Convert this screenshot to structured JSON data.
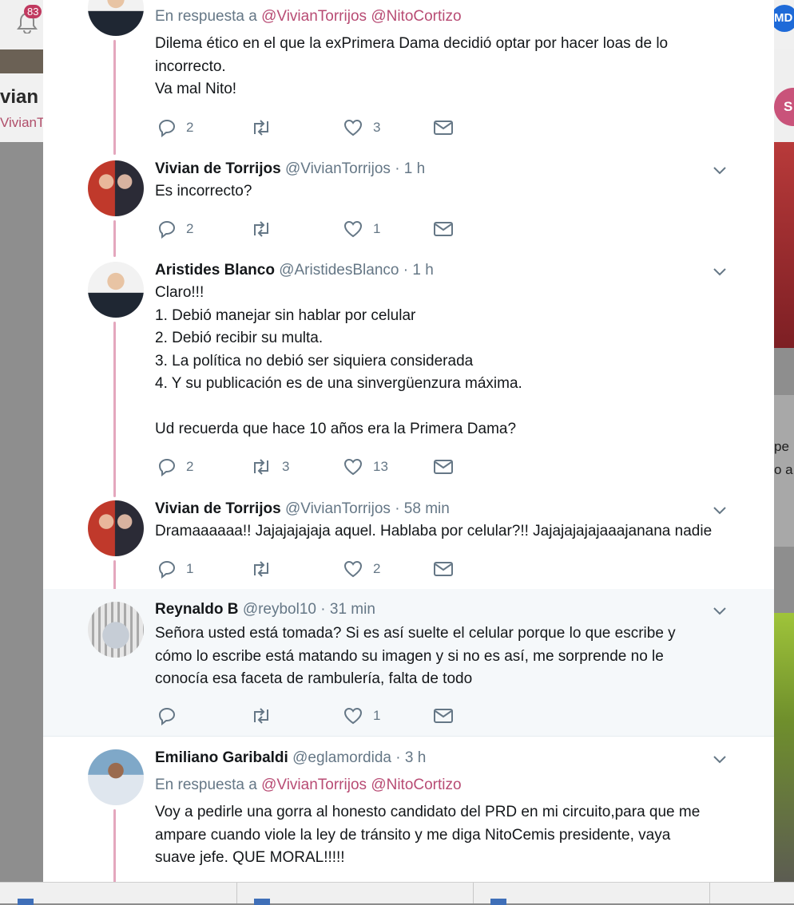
{
  "background": {
    "notifications_count": "83",
    "profile_name_partial": "vian",
    "profile_handle_partial": "VivianT",
    "right_avatar_label": "MD",
    "right_button_partial": "S",
    "right_card_text": [
      "pe",
      "o a"
    ]
  },
  "colors": {
    "mention": "#b84c74",
    "thread_line": "#e4a7bd",
    "highlight_row": "#f5f8fa",
    "meta_text": "#657786"
  },
  "tweets": [
    {
      "reply_label": "En respuesta a",
      "mentions": [
        "@VivianTorrijos",
        "@NitoCortizo"
      ],
      "lines": [
        "Dilema ético en el que la exPrimera Dama decidió optar por hacer loas de lo",
        "incorrecto.",
        "Va mal Nito!"
      ],
      "counts": {
        "replies": "2",
        "retweets": "",
        "likes": "3"
      }
    },
    {
      "name": "Vivian de Torrijos",
      "handle": "@VivianTorrijos",
      "time": "· 1 h",
      "lines": [
        "Es incorrecto?"
      ],
      "counts": {
        "replies": "2",
        "retweets": "",
        "likes": "1"
      }
    },
    {
      "name": "Aristides Blanco",
      "handle": "@AristidesBlanco",
      "time": "· 1 h",
      "lines": [
        "Claro!!!",
        "1. Debió manejar sin hablar por celular",
        "2. Debió recibir su multa.",
        "3. La política no debió ser siquiera considerada",
        "4. Y su publicación es de una sinvergüenzura máxima.",
        "",
        "Ud recuerda que hace 10 años era la Primera Dama?"
      ],
      "counts": {
        "replies": "2",
        "retweets": "3",
        "likes": "13"
      }
    },
    {
      "name": "Vivian de Torrijos",
      "handle": "@VivianTorrijos",
      "time": "· 58 min",
      "lines": [
        "Dramaaaaaa!! Jajajajajaja aquel. Hablaba por celular?!! Jajajajajajaaajanana nadie"
      ],
      "counts": {
        "replies": "1",
        "retweets": "",
        "likes": "2"
      }
    },
    {
      "name": "Reynaldo B",
      "handle": "@reybol10",
      "time": "· 31 min",
      "lines": [
        "Señora usted está tomada? Si es así suelte el celular porque lo que escribe y",
        "cómo lo escribe está matando su imagen y si no es así, me sorprende no le",
        "conocía esa faceta de rambulería, falta de todo"
      ],
      "counts": {
        "replies": "",
        "retweets": "",
        "likes": "1"
      }
    },
    {
      "name": "Emiliano Garibaldi",
      "handle": "@eglamordida",
      "time": "· 3 h",
      "reply_label": "En respuesta a",
      "mentions": [
        "@VivianTorrijos",
        "@NitoCortizo"
      ],
      "lines": [
        "Voy a pedirle una gorra al honesto candidato del PRD en mi circuito,para que me",
        "ampare cuando viole la ley de tránsito y me diga NitoCemis presidente, vaya",
        "suave jefe. QUE MORAL!!!!!"
      ]
    }
  ]
}
